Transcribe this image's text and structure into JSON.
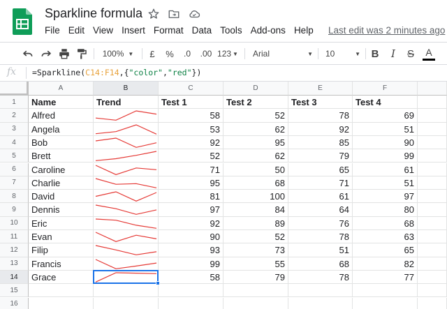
{
  "app": {
    "title": "Sparkline formula",
    "last_edit": "Last edit was 2 minutes ago",
    "brand_color": "#0f9d58"
  },
  "title_icons": [
    "star-icon",
    "move-to-folder-icon",
    "cloud-status-icon"
  ],
  "menu": [
    "File",
    "Edit",
    "View",
    "Insert",
    "Format",
    "Data",
    "Tools",
    "Add-ons",
    "Help"
  ],
  "toolbar": {
    "zoom": "100%",
    "currency": "£",
    "percent": "%",
    "decrease_decimal": ".0",
    "increase_decimal": ".00",
    "more_formats": "123",
    "font": "Arial",
    "font_size": "10",
    "bold": "B",
    "italic": "I",
    "strikethrough": "S",
    "text_color": "A"
  },
  "formula_bar": {
    "fx": "fx",
    "prefix": "=Sparkline(",
    "range": "C14:F14",
    "mid1": ",{",
    "key": "\"color\"",
    "comma": ",",
    "value": "\"red\"",
    "suffix": "})"
  },
  "columns": [
    "A",
    "B",
    "C",
    "D",
    "E",
    "F"
  ],
  "selected_column": "B",
  "selected_row": 14,
  "sparkline_color": "#e53935",
  "rows": [
    {
      "n": "1",
      "cells": [
        "Name",
        "Trend",
        "Test 1",
        "Test 2",
        "Test 3",
        "Test 4"
      ],
      "header": true
    },
    {
      "n": "2",
      "cells": [
        "Alfred",
        "",
        "58",
        "52",
        "78",
        "69"
      ],
      "spark": [
        58,
        52,
        78,
        69
      ]
    },
    {
      "n": "3",
      "cells": [
        "Angela",
        "",
        "53",
        "62",
        "92",
        "51"
      ],
      "spark": [
        53,
        62,
        92,
        51
      ]
    },
    {
      "n": "4",
      "cells": [
        "Bob",
        "",
        "92",
        "95",
        "85",
        "90"
      ],
      "spark": [
        92,
        95,
        85,
        90
      ]
    },
    {
      "n": "5",
      "cells": [
        "Brett",
        "",
        "52",
        "62",
        "79",
        "99"
      ],
      "spark": [
        52,
        62,
        79,
        99
      ]
    },
    {
      "n": "6",
      "cells": [
        "Caroline",
        "",
        "71",
        "50",
        "65",
        "61"
      ],
      "spark": [
        71,
        50,
        65,
        61
      ]
    },
    {
      "n": "7",
      "cells": [
        "Charlie",
        "",
        "95",
        "68",
        "71",
        "51"
      ],
      "spark": [
        95,
        68,
        71,
        51
      ]
    },
    {
      "n": "8",
      "cells": [
        "David",
        "",
        "81",
        "100",
        "61",
        "97"
      ],
      "spark": [
        81,
        100,
        61,
        97
      ]
    },
    {
      "n": "9",
      "cells": [
        "Dennis",
        "",
        "97",
        "84",
        "64",
        "80"
      ],
      "spark": [
        97,
        84,
        64,
        80
      ]
    },
    {
      "n": "10",
      "cells": [
        "Eric",
        "",
        "92",
        "89",
        "76",
        "68"
      ],
      "spark": [
        92,
        89,
        76,
        68
      ]
    },
    {
      "n": "11",
      "cells": [
        "Evan",
        "",
        "90",
        "52",
        "78",
        "63"
      ],
      "spark": [
        90,
        52,
        78,
        63
      ]
    },
    {
      "n": "12",
      "cells": [
        "Filip",
        "",
        "93",
        "73",
        "51",
        "65"
      ],
      "spark": [
        93,
        73,
        51,
        65
      ]
    },
    {
      "n": "13",
      "cells": [
        "Francis",
        "",
        "99",
        "55",
        "68",
        "82"
      ],
      "spark": [
        99,
        55,
        68,
        82
      ]
    },
    {
      "n": "14",
      "cells": [
        "Grace",
        "",
        "58",
        "79",
        "78",
        "77"
      ],
      "spark": [
        58,
        79,
        78,
        77
      ]
    },
    {
      "n": "15",
      "cells": [
        "",
        "",
        "",
        "",
        "",
        ""
      ]
    },
    {
      "n": "16",
      "cells": [
        "",
        "",
        "",
        "",
        "",
        ""
      ]
    }
  ]
}
